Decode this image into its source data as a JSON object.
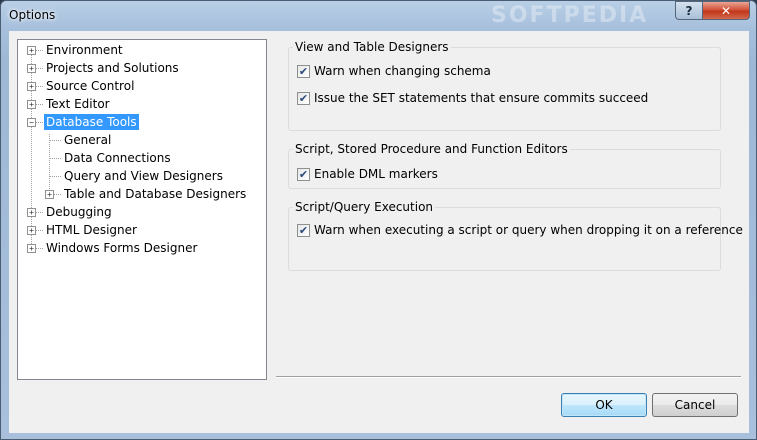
{
  "window": {
    "title": "Options",
    "watermark": "SOFTPEDIA",
    "help_glyph": "?",
    "close_glyph": "✕"
  },
  "tree": {
    "items": [
      {
        "label": "Environment",
        "expander": "+"
      },
      {
        "label": "Projects and Solutions",
        "expander": "+"
      },
      {
        "label": "Source Control",
        "expander": "+"
      },
      {
        "label": "Text Editor",
        "expander": "+"
      },
      {
        "label": "Database Tools",
        "expander": "−",
        "selected": true
      },
      {
        "label": "General"
      },
      {
        "label": "Data Connections"
      },
      {
        "label": "Query and View Designers"
      },
      {
        "label": "Table and Database Designers",
        "expander": "+"
      },
      {
        "label": "Debugging",
        "expander": "+"
      },
      {
        "label": "HTML Designer",
        "expander": "+"
      },
      {
        "label": "Windows Forms Designer",
        "expander": "+"
      }
    ]
  },
  "groups": [
    {
      "title": "View and Table Designers",
      "options": [
        {
          "label": "Warn when changing schema",
          "checked": true
        },
        {
          "label": "Issue the SET statements that ensure commits succeed",
          "checked": true
        }
      ]
    },
    {
      "title": "Script, Stored Procedure and Function Editors",
      "options": [
        {
          "label": "Enable DML markers",
          "checked": true
        }
      ]
    },
    {
      "title": "Script/Query Execution",
      "options": [
        {
          "label": "Warn when executing a script or query when dropping it on a reference",
          "checked": true
        }
      ]
    }
  ],
  "check_glyph": "✔",
  "buttons": {
    "ok": "OK",
    "cancel": "Cancel"
  }
}
